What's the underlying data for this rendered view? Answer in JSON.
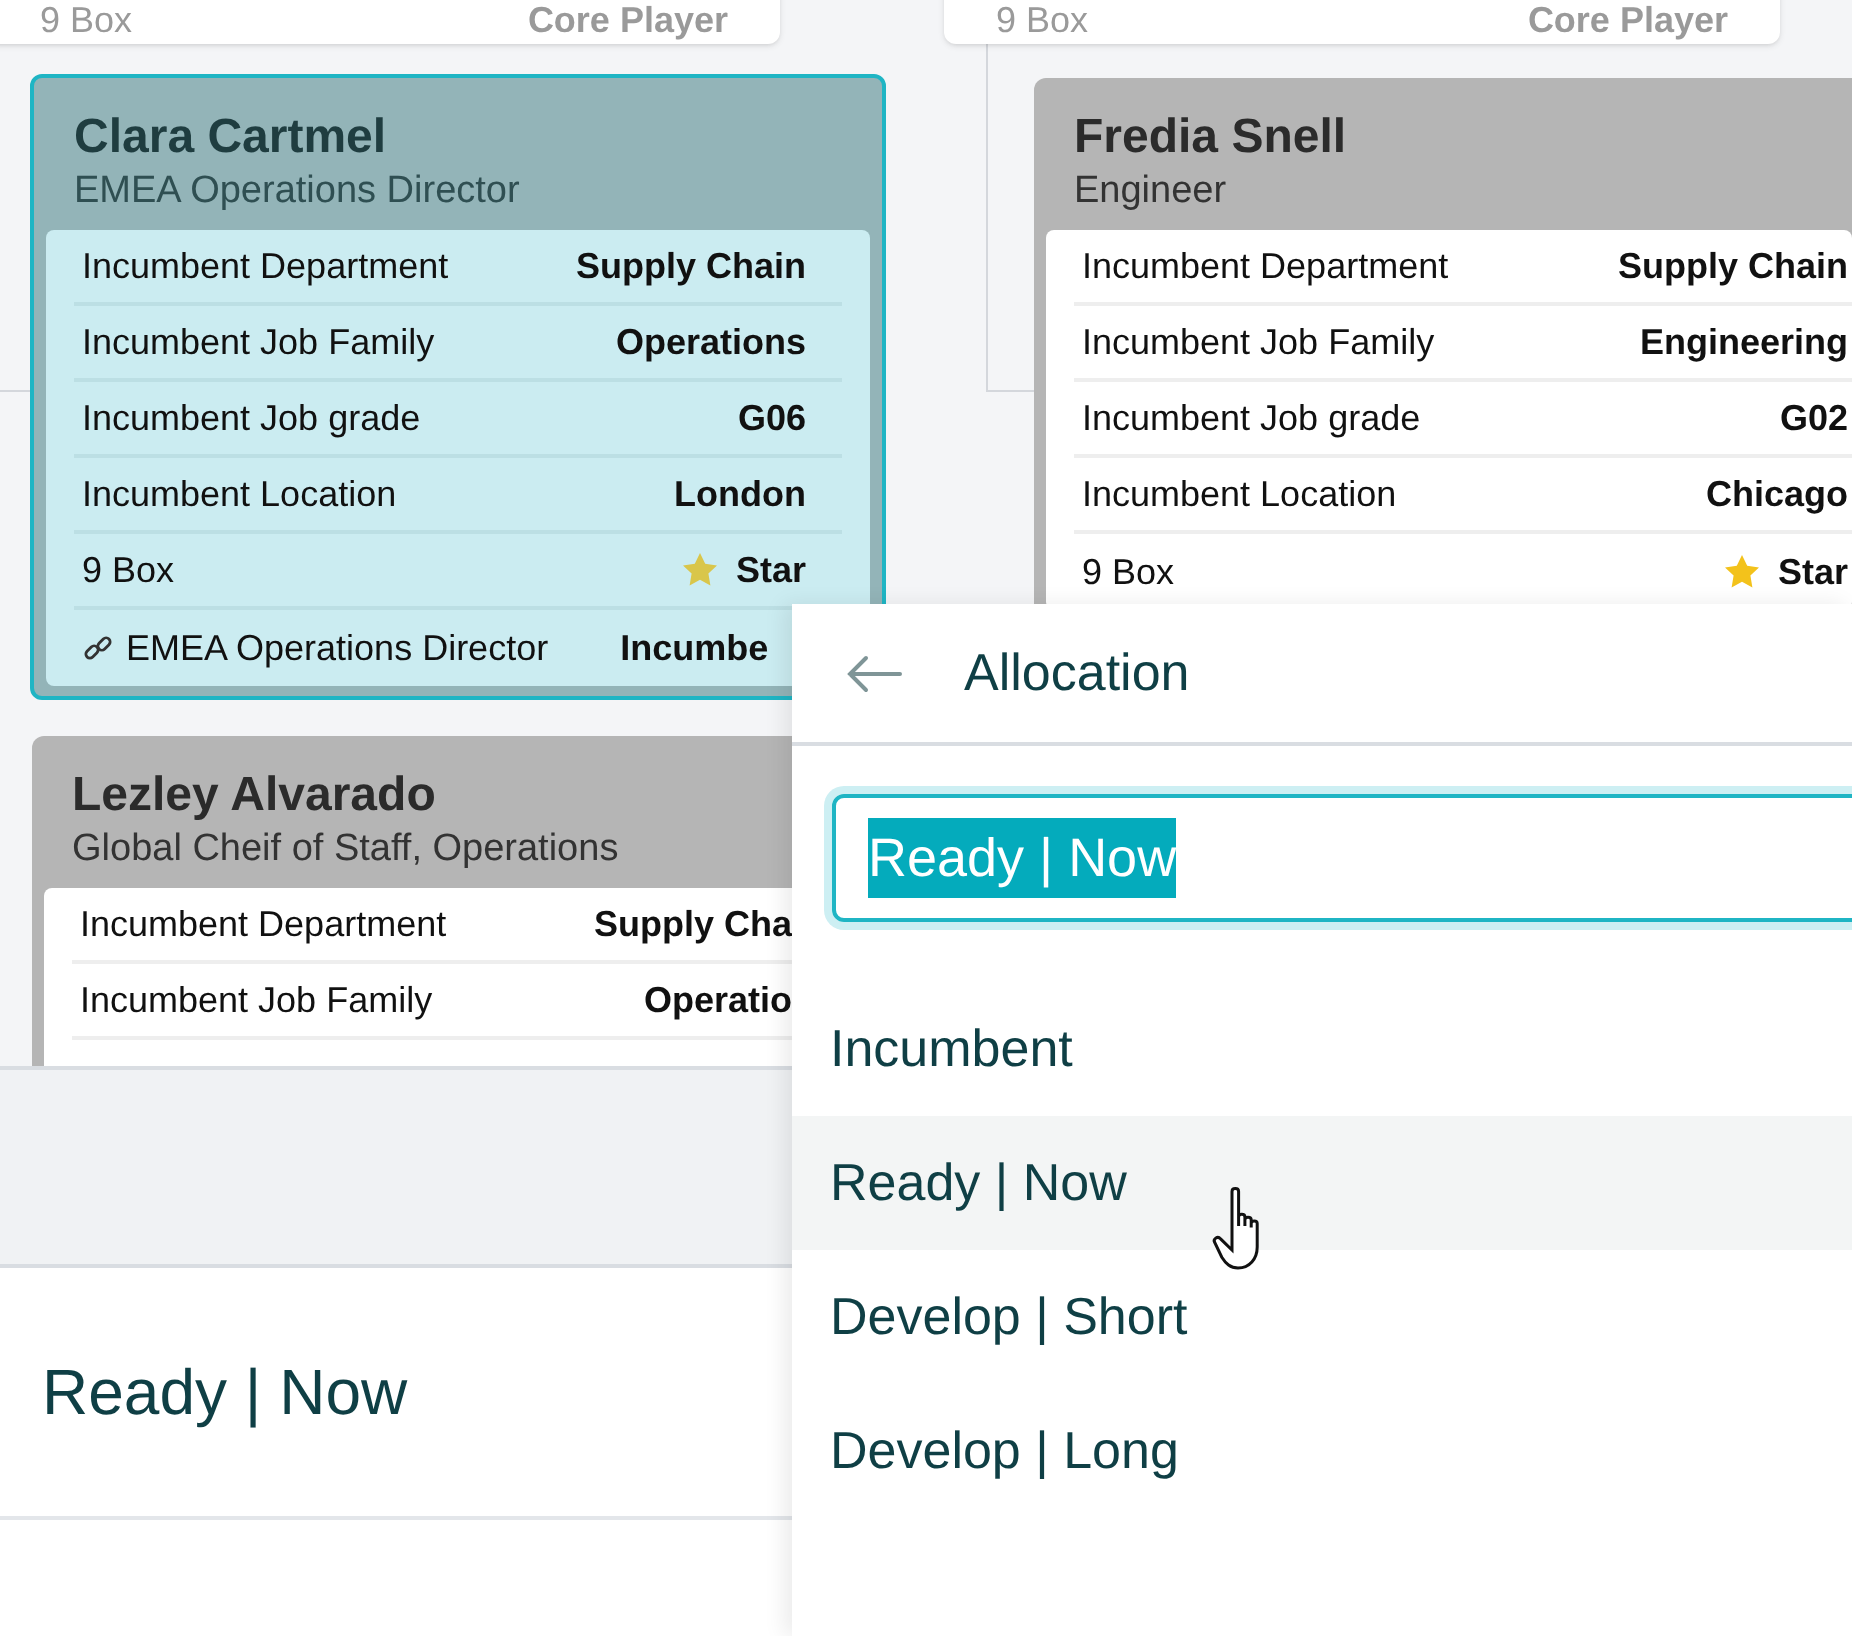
{
  "top_cards": [
    {
      "label": "9 Box",
      "value": "Core Player"
    },
    {
      "label": "9 Box",
      "value": "Core Player"
    }
  ],
  "cards": [
    {
      "name": "Clara Cartmel",
      "title": "EMEA Operations Director",
      "selected": true,
      "rows": [
        {
          "kind": "field",
          "label": "Incumbent Department",
          "value": "Supply Chain"
        },
        {
          "kind": "field",
          "label": "Incumbent Job Family",
          "value": "Operations"
        },
        {
          "kind": "field",
          "label": "Incumbent Job grade",
          "value": "G06"
        },
        {
          "kind": "field",
          "label": "Incumbent Location",
          "value": "London"
        },
        {
          "kind": "rating",
          "label": "9 Box",
          "value": "Star"
        },
        {
          "kind": "link",
          "label": "EMEA Operations Director",
          "value": "Incumbe"
        }
      ]
    },
    {
      "name": "Fredia Snell",
      "title": "Engineer",
      "selected": false,
      "rows": [
        {
          "kind": "field",
          "label": "Incumbent Department",
          "value": "Supply Chain"
        },
        {
          "kind": "field",
          "label": "Incumbent Job Family",
          "value": "Engineering"
        },
        {
          "kind": "field",
          "label": "Incumbent Job grade",
          "value": "G02"
        },
        {
          "kind": "field",
          "label": "Incumbent Location",
          "value": "Chicago"
        },
        {
          "kind": "rating",
          "label": "9 Box",
          "value": "Star"
        }
      ]
    },
    {
      "name": "Lezley Alvarado",
      "title": "Global Cheif of Staff, Operations",
      "selected": false,
      "rows": [
        {
          "kind": "field",
          "label": "Incumbent Department",
          "value": "Supply Cha"
        },
        {
          "kind": "field",
          "label": "Incumbent Job Family",
          "value": "Operatio"
        }
      ]
    }
  ],
  "detail": {
    "value": "Ready | Now"
  },
  "allocation": {
    "title": "Allocation",
    "search": {
      "value": "Ready | Now"
    },
    "options": [
      {
        "label": "Incumbent",
        "hovered": false
      },
      {
        "label": "Ready | Now",
        "hovered": true
      },
      {
        "label": "Develop | Short",
        "hovered": false
      },
      {
        "label": "Develop | Long",
        "hovered": false
      }
    ]
  }
}
